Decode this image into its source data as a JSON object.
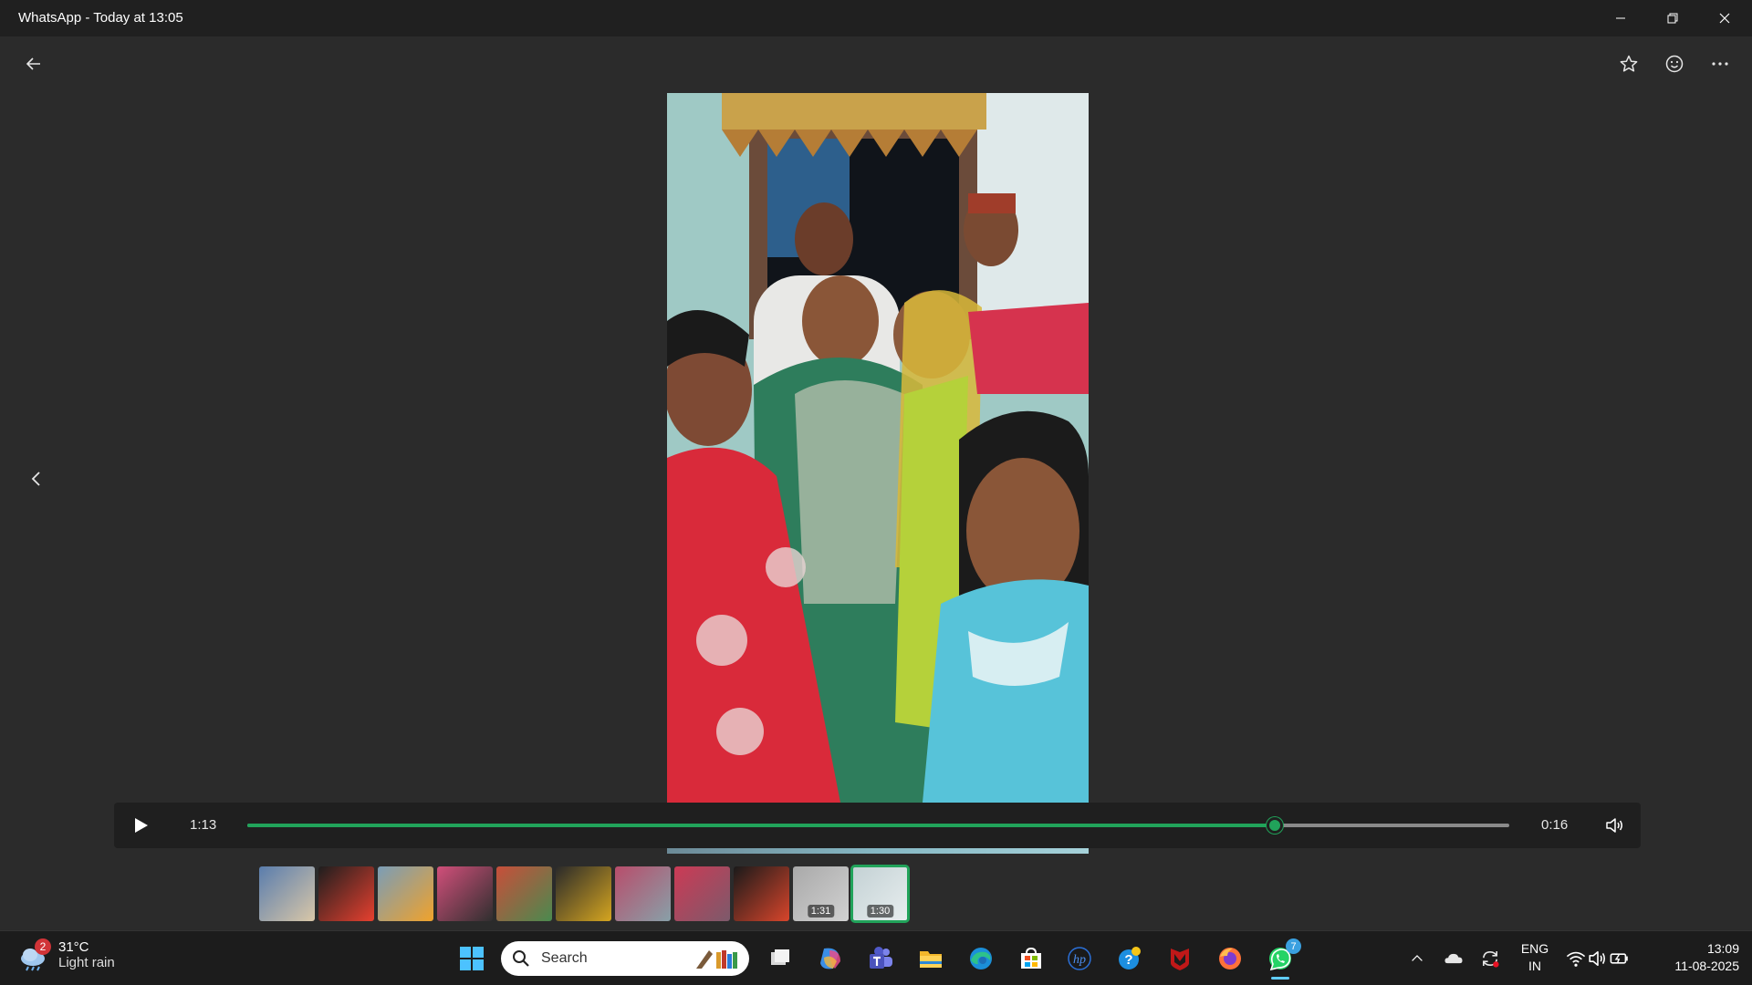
{
  "window": {
    "title": "WhatsApp - Today at 13:05",
    "controls": [
      "minimize-icon",
      "restore-icon",
      "close-icon"
    ]
  },
  "viewer": {
    "header_icons": [
      "back-arrow-icon",
      "star-icon",
      "emoji-icon",
      "more-icon"
    ],
    "nav_icon": "chevron-left-icon"
  },
  "player": {
    "elapsed": "1:13",
    "remaining": "0:16",
    "progress": 0.814,
    "accent": "#21a35a"
  },
  "thumbnails": [
    {
      "duration": "",
      "colors": [
        "#5a7dad",
        "#d9c7a8"
      ]
    },
    {
      "duration": "",
      "colors": [
        "#1e1e1e",
        "#e7402f"
      ]
    },
    {
      "duration": "",
      "colors": [
        "#7a9db7",
        "#f0a22b"
      ]
    },
    {
      "duration": "",
      "colors": [
        "#d14f7a",
        "#2f2f2f"
      ]
    },
    {
      "duration": "",
      "colors": [
        "#c84e3a",
        "#4a8a4f"
      ]
    },
    {
      "duration": "",
      "colors": [
        "#2a2a2a",
        "#d5a520"
      ]
    },
    {
      "duration": "",
      "colors": [
        "#b84d6b",
        "#88a0a8"
      ]
    },
    {
      "duration": "",
      "colors": [
        "#cc3a55",
        "#7c5a6b"
      ]
    },
    {
      "duration": "",
      "colors": [
        "#1a1a1a",
        "#d8452b"
      ]
    },
    {
      "duration": "1:31",
      "colors": [
        "#a9a9a9",
        "#d1d1d1"
      ]
    },
    {
      "duration": "1:30",
      "colors": [
        "#c3d1d4",
        "#e8eeef"
      ],
      "selected": true
    }
  ],
  "taskbar": {
    "weather": {
      "badge": "2",
      "temp": "31°C",
      "condition": "Light rain"
    },
    "search_label": "Search",
    "apps": [
      "windows-start",
      "search",
      "task-view",
      "copilot",
      "teams",
      "file-explorer",
      "edge",
      "microsoft-store",
      "hp",
      "get-help",
      "mcafee",
      "firefox",
      "whatsapp"
    ],
    "whatsapp_badge": "7",
    "tray": {
      "lang_top": "ENG",
      "lang_bottom": "IN",
      "time": "13:09",
      "date": "11-08-2025"
    }
  }
}
